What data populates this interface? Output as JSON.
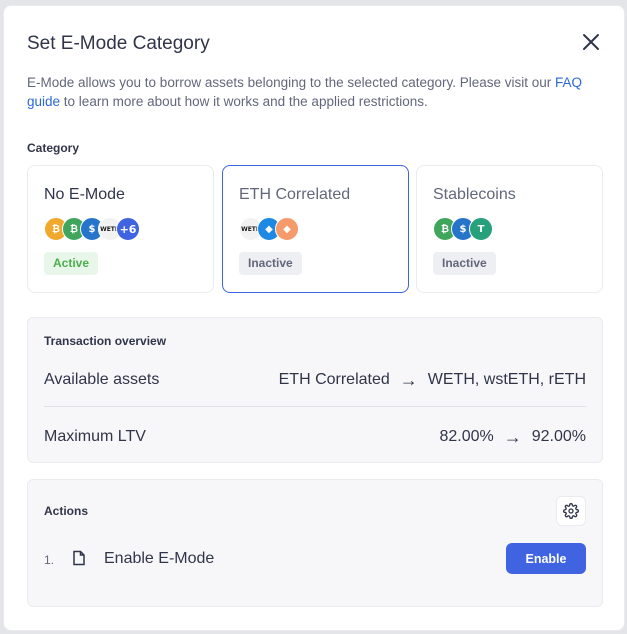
{
  "modal": {
    "title": "Set E-Mode Category",
    "desc_before": "E-Mode allows you to borrow assets belonging to the selected category. Please visit our ",
    "desc_link": "FAQ guide",
    "desc_after": " to learn more about how it works and the applied restrictions."
  },
  "category": {
    "label": "Category",
    "cards": [
      {
        "title": "No E-Mode",
        "badge": "Active",
        "icons": [
          "usdc-icon",
          "usdc-icon",
          "usdc-icon",
          "weth-icon"
        ],
        "more": "+6"
      },
      {
        "title": "ETH Correlated",
        "badge": "Inactive",
        "icons": [
          "weth-icon",
          "wsteth-icon",
          "reth-icon"
        ]
      },
      {
        "title": "Stablecoins",
        "badge": "Inactive",
        "icons": [
          "usdc-icon",
          "usdc-icon",
          "usdt-icon"
        ]
      }
    ]
  },
  "overview": {
    "title": "Transaction overview",
    "available_label": "Available assets",
    "available_from": "ETH Correlated",
    "available_to": "WETH, wstETH, rETH",
    "ltv_label": "Maximum LTV",
    "ltv_from": "82.00%",
    "ltv_to": "92.00%"
  },
  "actions": {
    "title": "Actions",
    "step_number": "1.",
    "step_label": "Enable E-Mode",
    "button_label": "Enable"
  },
  "colors": {
    "accent": "#3f63e1",
    "active_green": "#4caf50",
    "selected_border": "#3b64e0"
  }
}
